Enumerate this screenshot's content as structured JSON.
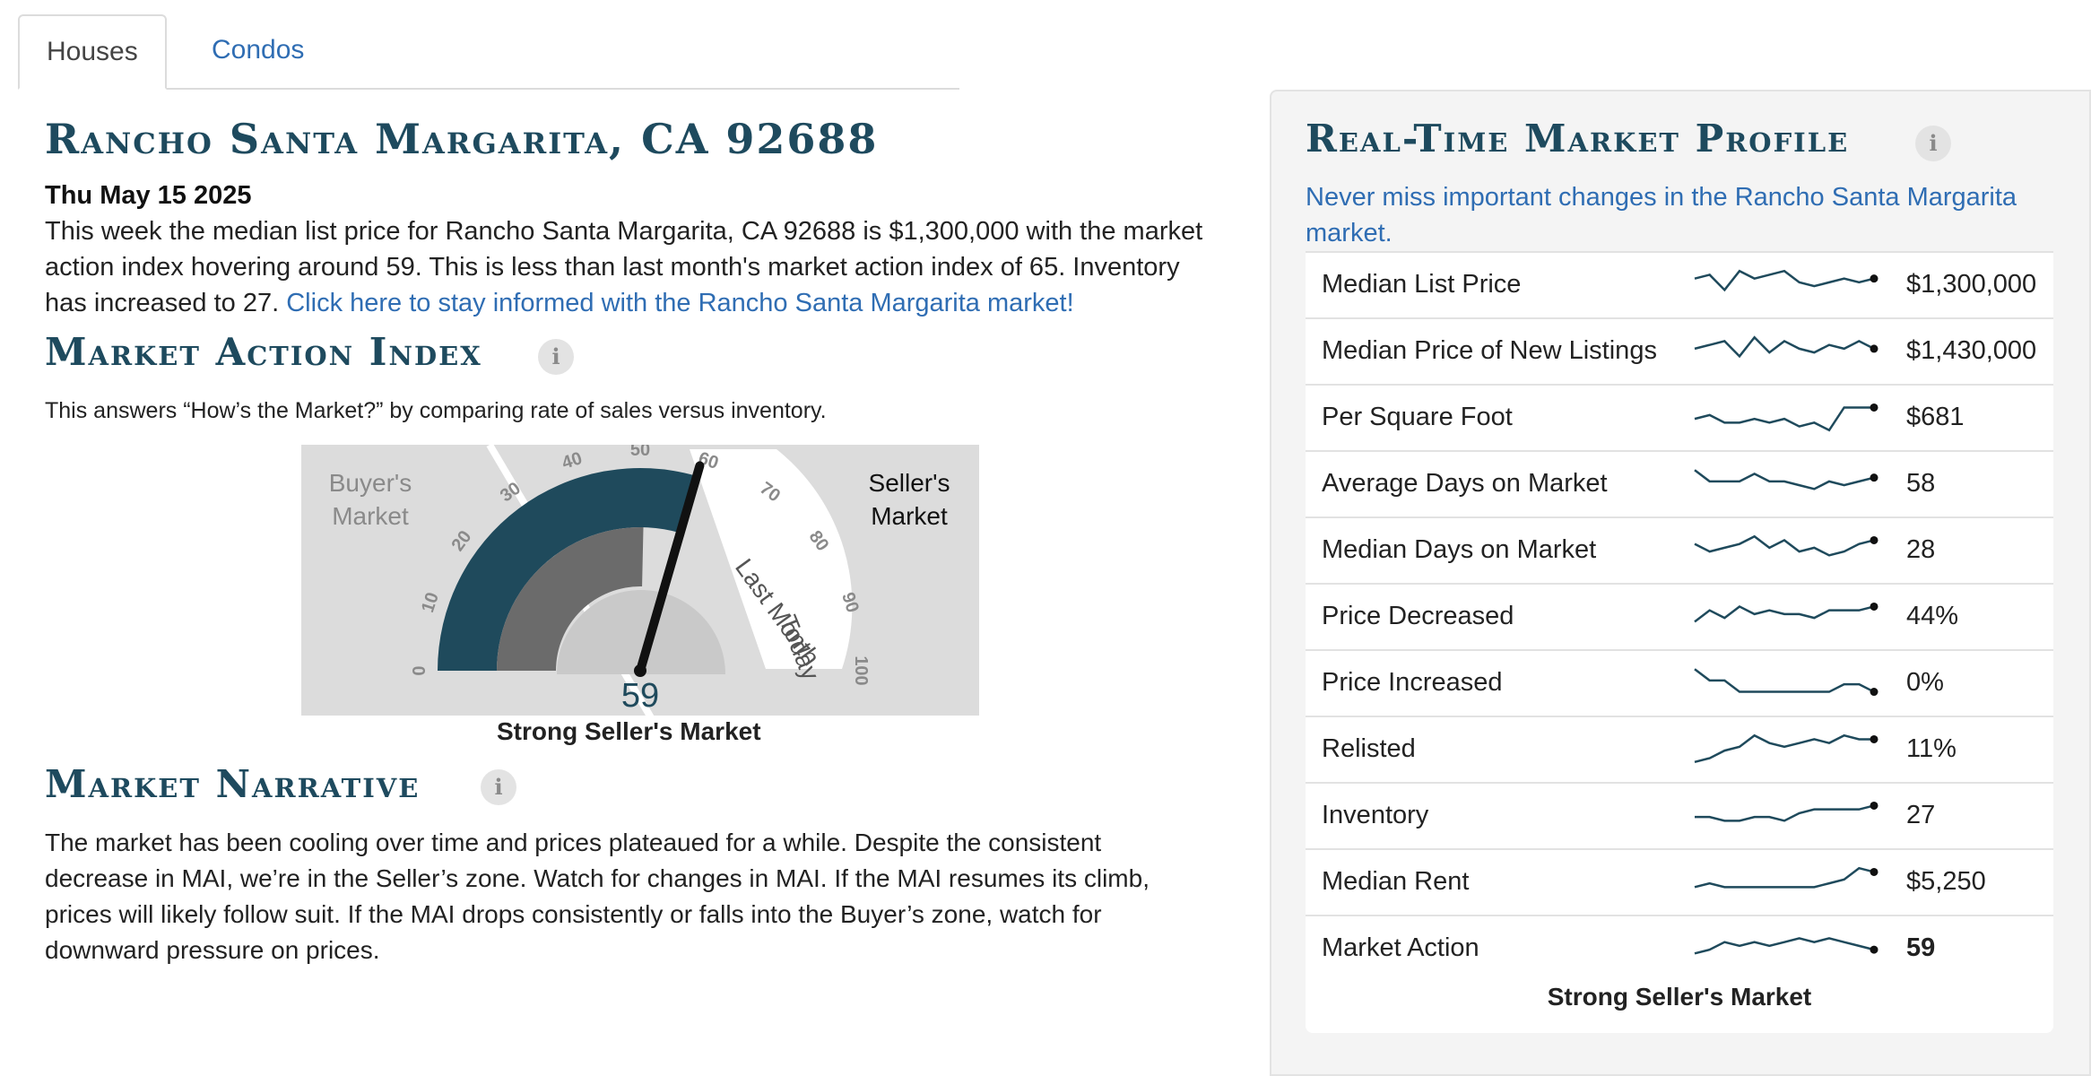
{
  "tabs": [
    "Houses",
    "Condos"
  ],
  "title": "Rancho Santa Margarita, CA 92688",
  "date": "Thu May 15 2025",
  "summary": {
    "text": "This week the median list price for Rancho Santa Margarita, CA 92688 is $1,300,000 with the market action index hovering around 59. This is less than last month's market action index of 65. Inventory has increased to 27. ",
    "link": "Click here to stay informed with the Rancho Santa Margarita market!"
  },
  "mai": {
    "heading": "Market Action Index",
    "info": "i",
    "description": "This answers “How’s the Market?” by comparing rate of sales versus inventory.",
    "gauge": {
      "buyers_label": [
        "Buyer's",
        "Market"
      ],
      "sellers_label": [
        "Seller's",
        "Market"
      ],
      "ticks": [
        "0",
        "10",
        "20",
        "30",
        "40",
        "50",
        "60",
        "70",
        "80",
        "90",
        "100"
      ],
      "value": 59,
      "last_month_value": 65,
      "value_label": "59",
      "last_month_label": "Last Month",
      "today_label": "Today",
      "colors": {
        "current": "#1f4a5c",
        "last_month": "#6b6b6b",
        "background": "#dcdcdc"
      }
    },
    "caption": "Strong Seller's Market"
  },
  "narrative": {
    "heading": "Market Narrative",
    "info": "i",
    "text": "The market has been cooling over time and prices plateaued for a while. Despite the consistent decrease in MAI, we’re in the Seller’s zone. Watch for changes in MAI. If the MAI resumes its climb, prices will likely follow suit. If the MAI drops consistently or falls into the Buyer’s zone, watch for downward pressure on prices."
  },
  "profile": {
    "heading": "Real-Time Market Profile",
    "info": "i",
    "subtitle": "Never miss important changes in the Rancho Santa Margarita market.",
    "rows": [
      {
        "label": "Median List Price",
        "value": "$1,300,000",
        "trend": [
          6,
          7,
          3,
          8,
          6,
          7,
          8,
          5,
          4,
          5,
          6,
          5,
          6
        ]
      },
      {
        "label": "Median Price of New Listings",
        "value": "$1,430,000",
        "trend": [
          5,
          6,
          7,
          3,
          8,
          4,
          7,
          5,
          4,
          6,
          5,
          7,
          5
        ]
      },
      {
        "label": "Per Square Foot",
        "value": "$681",
        "trend": [
          4,
          5,
          3,
          3,
          4,
          3,
          4,
          2,
          3,
          1,
          7,
          7,
          7
        ]
      },
      {
        "label": "Average Days on Market",
        "value": "58",
        "trend": [
          8,
          5,
          5,
          5,
          7,
          5,
          5,
          4,
          3,
          5,
          4,
          5,
          6
        ]
      },
      {
        "label": "Median Days on Market",
        "value": "28",
        "trend": [
          6,
          4,
          5,
          6,
          8,
          5,
          7,
          4,
          5,
          3,
          4,
          6,
          7
        ]
      },
      {
        "label": "Price Decreased",
        "value": "44%",
        "trend": [
          3,
          6,
          4,
          7,
          5,
          6,
          5,
          5,
          4,
          6,
          6,
          6,
          7
        ]
      },
      {
        "label": "Price Increased",
        "value": "0%",
        "trend": [
          8,
          5,
          5,
          2,
          2,
          2,
          2,
          2,
          2,
          2,
          4,
          4,
          2
        ]
      },
      {
        "label": "Relisted",
        "value": "11%",
        "trend": [
          1,
          2,
          4,
          5,
          8,
          6,
          5,
          6,
          7,
          6,
          8,
          7,
          7
        ]
      },
      {
        "label": "Inventory",
        "value": "27",
        "trend": [
          4,
          4,
          3,
          3,
          4,
          4,
          3,
          5,
          6,
          6,
          6,
          6,
          7
        ]
      },
      {
        "label": "Median Rent",
        "value": "$5,250",
        "trend": [
          3,
          4,
          3,
          3,
          3,
          3,
          3,
          3,
          3,
          4,
          5,
          8,
          7
        ]
      },
      {
        "label": "Market Action",
        "value": "59",
        "trend": [
          3,
          4,
          6,
          5,
          6,
          5,
          6,
          7,
          6,
          7,
          6,
          5,
          4
        ],
        "bold": true
      }
    ],
    "footer": "Strong Seller's Market"
  }
}
